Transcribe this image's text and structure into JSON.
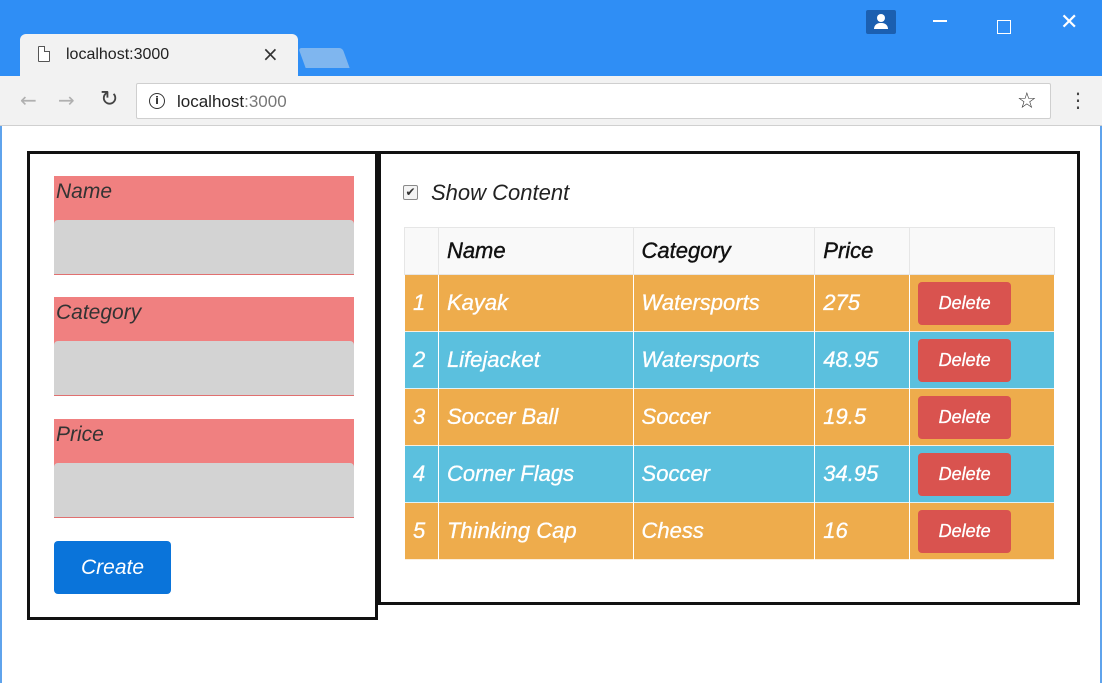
{
  "browser": {
    "tab_title": "localhost:3000",
    "tab_close_glyph": "×",
    "url_host": "localhost",
    "url_port": ":3000",
    "icons": [
      "page-icon",
      "close-icon",
      "back-icon",
      "forward-icon",
      "reload-icon",
      "info-icon",
      "star-icon",
      "menu-icon",
      "user-icon",
      "minimize-icon",
      "maximize-icon",
      "window-close-icon"
    ],
    "titlebar_color": "#2f8ef5"
  },
  "form": {
    "name_label": "Name",
    "category_label": "Category",
    "price_label": "Price",
    "name_value": "",
    "category_value": "",
    "price_value": "",
    "create_label": "Create",
    "label_color": "#f08080",
    "input_color": "#d3d3d3",
    "button_color": "#0a74da"
  },
  "table": {
    "show_content_label": "Show Content",
    "show_content_checked": true,
    "headers": [
      "",
      "Name",
      "Category",
      "Price",
      ""
    ],
    "rows": [
      {
        "index": "1",
        "name": "Kayak",
        "category": "Watersports",
        "price": "275",
        "action": "Delete"
      },
      {
        "index": "2",
        "name": "Lifejacket",
        "category": "Watersports",
        "price": "48.95",
        "action": "Delete"
      },
      {
        "index": "3",
        "name": "Soccer Ball",
        "category": "Soccer",
        "price": "19.5",
        "action": "Delete"
      },
      {
        "index": "4",
        "name": "Corner Flags",
        "category": "Soccer",
        "price": "34.95",
        "action": "Delete"
      },
      {
        "index": "5",
        "name": "Thinking Cap",
        "category": "Chess",
        "price": "16",
        "action": "Delete"
      }
    ],
    "odd_row_color": "#eeac4c",
    "even_row_color": "#5bc0de",
    "delete_color": "#d9534f"
  }
}
